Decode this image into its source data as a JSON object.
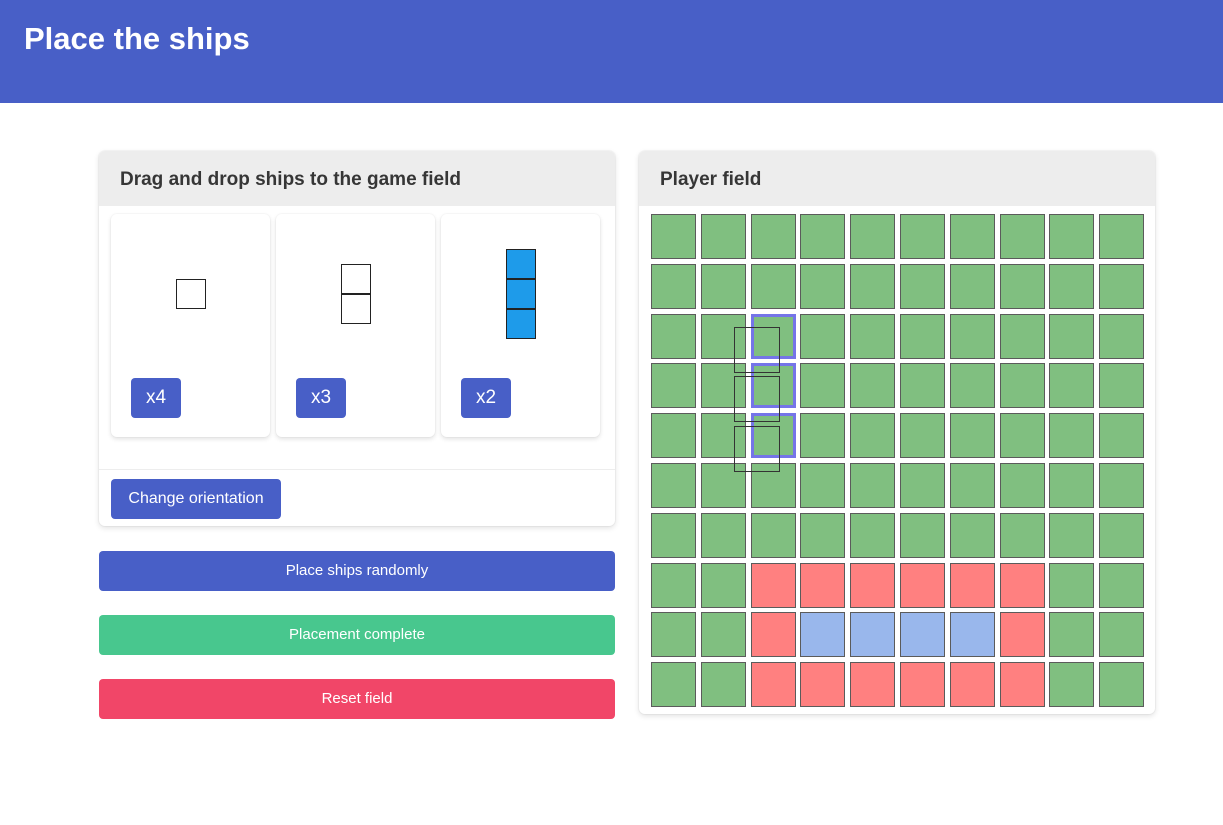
{
  "header": {
    "title": "Place the ships"
  },
  "ships_panel": {
    "title": "Drag and drop ships to the game field",
    "ships": [
      {
        "size": 1,
        "count_label": "x4",
        "selected": false
      },
      {
        "size": 2,
        "count_label": "x3",
        "selected": false
      },
      {
        "size": 3,
        "count_label": "x2",
        "selected": true
      }
    ],
    "change_orientation_label": "Change orientation"
  },
  "actions": {
    "random_label": "Place ships randomly",
    "complete_label": "Placement complete",
    "reset_label": "Reset field"
  },
  "player_field": {
    "title": "Player field",
    "rows": [
      [
        "water",
        "water",
        "water",
        "water",
        "water",
        "water",
        "water",
        "water",
        "water",
        "water"
      ],
      [
        "water",
        "water",
        "water",
        "water",
        "water",
        "water",
        "water",
        "water",
        "water",
        "water"
      ],
      [
        "water",
        "water",
        "hover",
        "water",
        "water",
        "water",
        "water",
        "water",
        "water",
        "water"
      ],
      [
        "water",
        "water",
        "hover",
        "water",
        "water",
        "water",
        "water",
        "water",
        "water",
        "water"
      ],
      [
        "water",
        "water",
        "hover",
        "water",
        "water",
        "water",
        "water",
        "water",
        "water",
        "water"
      ],
      [
        "water",
        "water",
        "water",
        "water",
        "water",
        "water",
        "water",
        "water",
        "water",
        "water"
      ],
      [
        "water",
        "water",
        "water",
        "water",
        "water",
        "water",
        "water",
        "water",
        "water",
        "water"
      ],
      [
        "water",
        "water",
        "blocked",
        "blocked",
        "blocked",
        "blocked",
        "blocked",
        "blocked",
        "water",
        "water"
      ],
      [
        "water",
        "water",
        "blocked",
        "ship",
        "ship",
        "ship",
        "ship",
        "blocked",
        "water",
        "water"
      ],
      [
        "water",
        "water",
        "blocked",
        "blocked",
        "blocked",
        "blocked",
        "blocked",
        "blocked",
        "water",
        "water"
      ]
    ]
  },
  "colors": {
    "primary": "#485fc7",
    "success": "#48c78e",
    "danger": "#f14668",
    "water": "#80bf80",
    "blocked": "#ff8080",
    "placed_ship": "#99b7ec",
    "selected_ship": "#1e9bea",
    "hover_border": "#7575e8"
  }
}
